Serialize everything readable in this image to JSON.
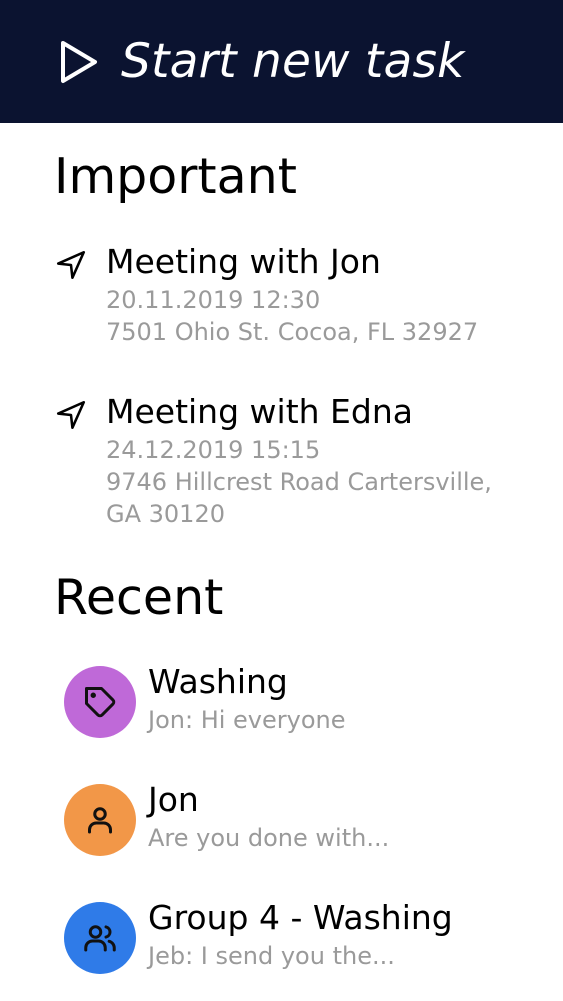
{
  "header": {
    "title": "Start new task",
    "icon": "play-icon"
  },
  "important": {
    "heading": "Important",
    "items": [
      {
        "title": "Meeting with Jon",
        "datetime": "20.11.2019 12:30",
        "address_line1": "7501 Ohio St. Cocoa, FL 32927",
        "address_line2": "",
        "icon": "navigation-icon"
      },
      {
        "title": "Meeting with Edna",
        "datetime": "24.12.2019 15:15",
        "address_line1": "9746 Hillcrest Road Cartersville,",
        "address_line2": "GA 30120",
        "icon": "navigation-icon"
      }
    ]
  },
  "recent": {
    "heading": "Recent",
    "items": [
      {
        "title": "Washing",
        "preview": "Jon: Hi everyone",
        "icon": "tag-icon",
        "color": "#bf69d8"
      },
      {
        "title": "Jon",
        "preview": "Are you done with...",
        "icon": "user-icon",
        "color": "#f29748"
      },
      {
        "title": "Group 4 - Washing",
        "preview": "Jeb: I send you the...",
        "icon": "users-icon",
        "color": "#2f7be8"
      }
    ]
  }
}
